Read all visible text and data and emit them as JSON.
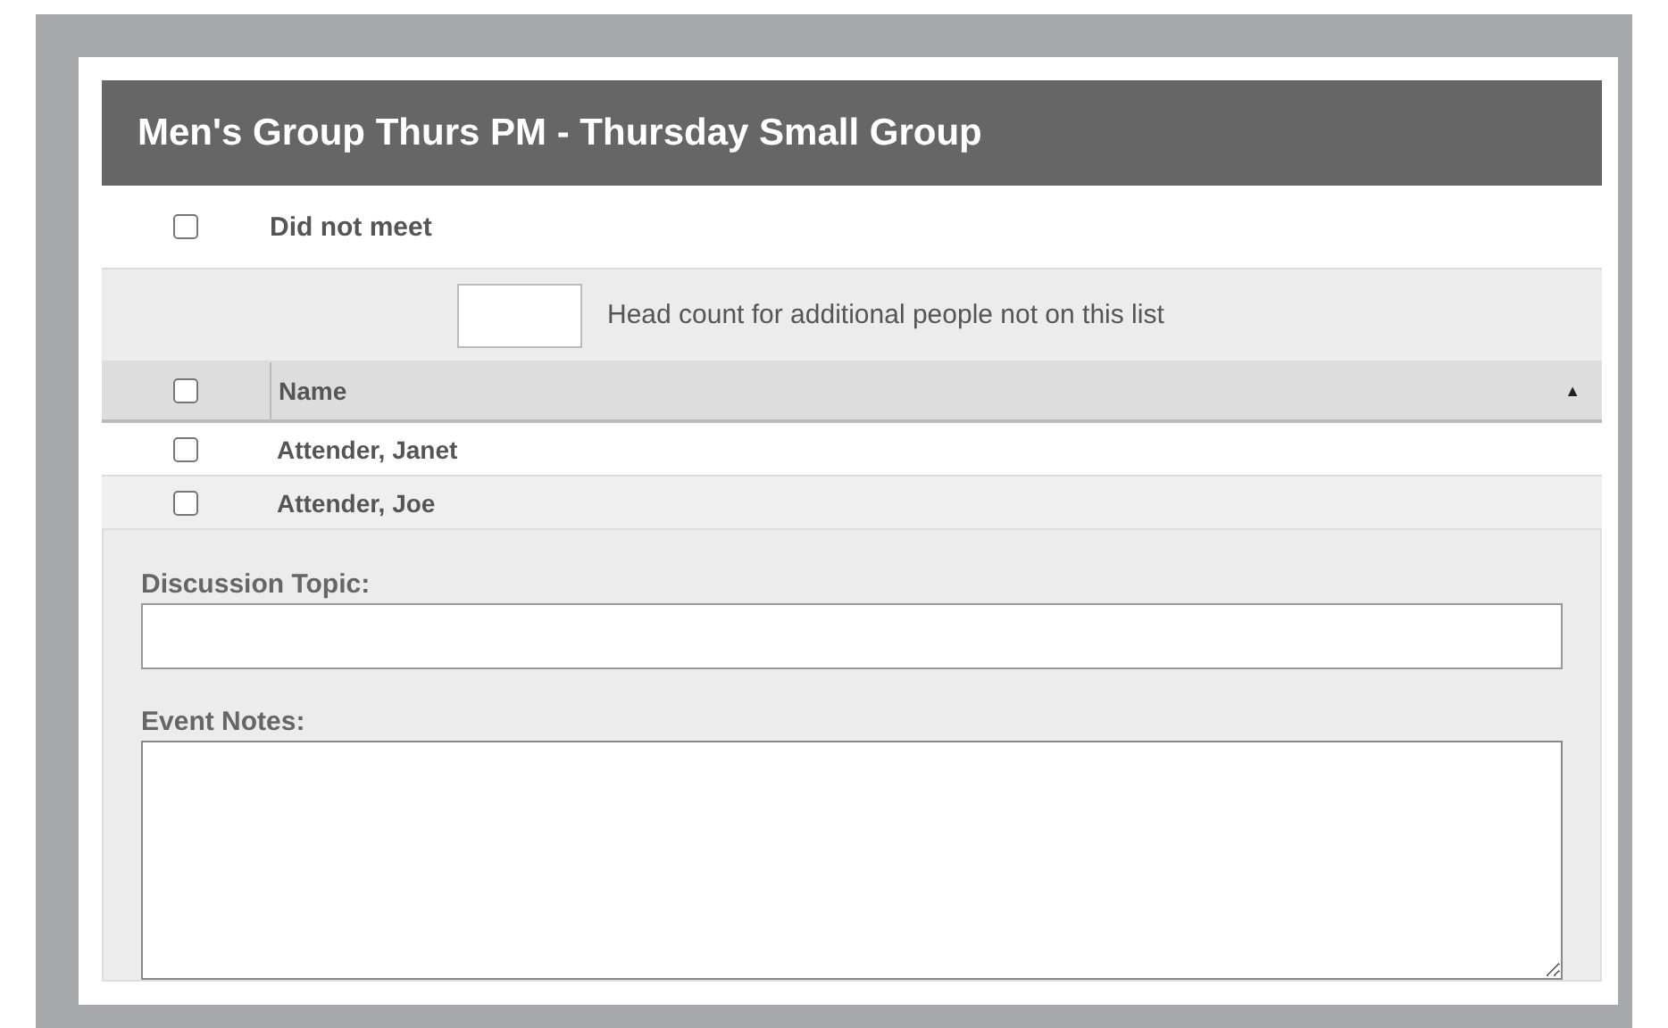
{
  "title": "Men's Group Thurs PM - Thursday Small Group",
  "did_not_meet": {
    "label": "Did not meet",
    "checked": false
  },
  "head_count": {
    "label": "Head count for additional people not on this list"
  },
  "table": {
    "select_all": {
      "checked": false
    },
    "columns": [
      {
        "label": "Name",
        "sort_arrow": "▲"
      }
    ],
    "rows": [
      {
        "name": "Attender, Janet",
        "checked": false
      },
      {
        "name": "Attender, Joe",
        "checked": false
      }
    ]
  },
  "fields": [
    {
      "label": "Discussion Topic:",
      "kind": "text"
    },
    {
      "label": "Event Notes:",
      "kind": "textarea"
    }
  ]
}
